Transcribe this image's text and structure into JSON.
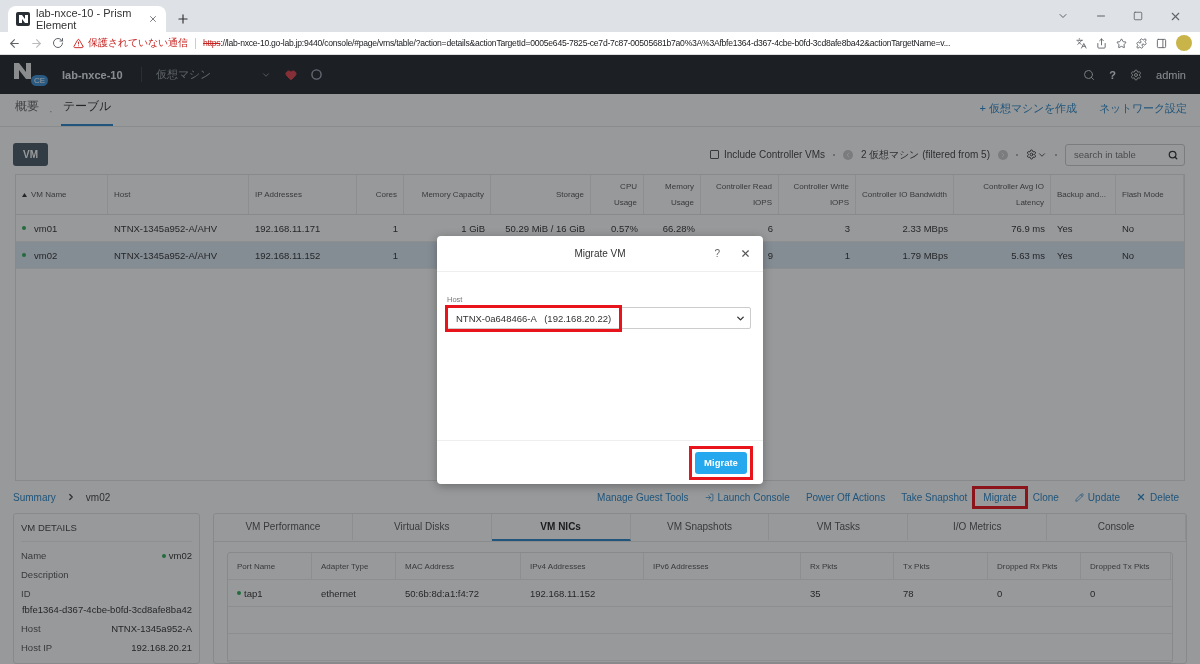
{
  "browser": {
    "tab_title": "lab-nxce-10 - Prism Element",
    "security_warning": "保護されていない通信",
    "url_scheme": "https",
    "url_rest": "://lab-nxce-10.go-lab.jp:9440/console/#page/vms/table/?action=details&actionTargetId=0005e645-7825-ce7d-7c87-00505681b7a0%3A%3Afbfe1364-d367-4cbe-b0fd-3cd8afe8ba42&actionTargetName=v..."
  },
  "header": {
    "logo_badge": "CE",
    "cluster": "lab-nxce-10",
    "menu": "仮想マシン",
    "help": "?",
    "user": "admin"
  },
  "view_tabs": [
    {
      "label": "概要",
      "selected": false
    },
    {
      "label": "テーブル",
      "selected": true
    }
  ],
  "view_separator": "·",
  "page_actions": [
    "+ 仮想マシンを作成",
    "ネットワーク設定"
  ],
  "entity_button": "VM",
  "toolbar": {
    "include_controller": {
      "label": "Include Controller VMs",
      "checked": false
    },
    "count": "2 仮想マシン (filtered from 5)",
    "search": {
      "placeholder": "search in table"
    }
  },
  "table": {
    "columns": [
      {
        "label": "VM Name",
        "sorted": true
      },
      {
        "label": "Host",
        "sorted": false
      },
      {
        "label": "IP Addresses",
        "sorted": false
      },
      {
        "label": "Cores",
        "sorted": false
      },
      {
        "label": "Memory Capacity",
        "sorted": false
      },
      {
        "label": "Storage",
        "sorted": false
      },
      {
        "label": "CPU Usage",
        "sorted": false
      },
      {
        "label": "Memory Usage",
        "sorted": false
      },
      {
        "label": "Controller Read IOPS",
        "sorted": false
      },
      {
        "label": "Controller Write IOPS",
        "sorted": false
      },
      {
        "label": "Controller IO Bandwidth",
        "sorted": false
      },
      {
        "label": "Controller Avg IO Latency",
        "sorted": false
      },
      {
        "label": "Backup and...",
        "sorted": false
      },
      {
        "label": "Flash Mode",
        "sorted": false
      }
    ],
    "rows": [
      {
        "selected": false,
        "powered_on": true,
        "cells": [
          "vm01",
          "NTNX-1345a952-A/AHV",
          "192.168.11.171",
          "1",
          "1 GiB",
          "50.29 MiB / 16 GiB",
          "0.57%",
          "66.28%",
          "6",
          "3",
          "2.33 MBps",
          "76.9 ms",
          "Yes",
          "No"
        ]
      },
      {
        "selected": true,
        "powered_on": true,
        "cells": [
          "vm02",
          "NTNX-1345a952-A/AHV",
          "192.168.11.152",
          "1",
          null,
          null,
          null,
          null,
          "9",
          "1",
          "1.79 MBps",
          "5.63 ms",
          "Yes",
          "No"
        ]
      }
    ]
  },
  "breadcrumb": {
    "link": "Summary",
    "current": "vm02"
  },
  "vm_actions": [
    {
      "label": "Manage Guest Tools",
      "kind": "plain",
      "highlighted": false
    },
    {
      "label": "Launch Console",
      "kind": "console",
      "highlighted": false
    },
    {
      "label": "Power Off Actions",
      "kind": "plain",
      "highlighted": false
    },
    {
      "label": "Take Snapshot",
      "kind": "plain",
      "highlighted": false
    },
    {
      "label": "Migrate",
      "kind": "plain",
      "highlighted": true
    },
    {
      "label": "Clone",
      "kind": "plain",
      "highlighted": false
    },
    {
      "label": "Update",
      "kind": "edit",
      "highlighted": false
    },
    {
      "label": "Delete",
      "kind": "delete",
      "highlighted": false
    }
  ],
  "vm_details": {
    "title": "VM DETAILS",
    "fields": [
      {
        "label": "Name",
        "value": "vm02",
        "status_dot": true
      },
      {
        "label": "Description",
        "status_dot": false
      },
      {
        "label": "ID",
        "value": "fbfe1364-d367-4cbe-b0fd-3cd8afe8ba42",
        "status_dot": false,
        "stacked": true
      },
      {
        "label": "Host",
        "value": "NTNX-1345a952-A",
        "status_dot": false
      },
      {
        "label": "Host IP",
        "value": "192.168.20.21",
        "status_dot": false
      }
    ]
  },
  "detail_tabs": [
    {
      "label": "VM Performance",
      "selected": false
    },
    {
      "label": "Virtual Disks",
      "selected": false
    },
    {
      "label": "VM NICs",
      "selected": true
    },
    {
      "label": "VM Snapshots",
      "selected": false
    },
    {
      "label": "VM Tasks",
      "selected": false
    },
    {
      "label": "I/O Metrics",
      "selected": false
    },
    {
      "label": "Console",
      "selected": false
    }
  ],
  "nics": {
    "columns": [
      "Port Name",
      "Adapter Type",
      "MAC Address",
      "IPv4 Addresses",
      "IPv6 Addresses",
      "Rx Pkts",
      "Tx Pkts",
      "Dropped Rx Pkts",
      "Dropped Tx Pkts"
    ],
    "rows": [
      {
        "connected": true,
        "cells": [
          "tap1",
          "ethernet",
          "50:6b:8d:a1:f4:72",
          "192.168.11.152",
          null,
          "35",
          "78",
          "0",
          "0"
        ]
      }
    ]
  },
  "dialog": {
    "title": "Migrate VM",
    "help": "?",
    "host_label": "Host",
    "host_value": "NTNX-0a648466-A   (192.168.20.22)",
    "host_highlighted": true,
    "button": "Migrate",
    "button_highlighted": true
  }
}
